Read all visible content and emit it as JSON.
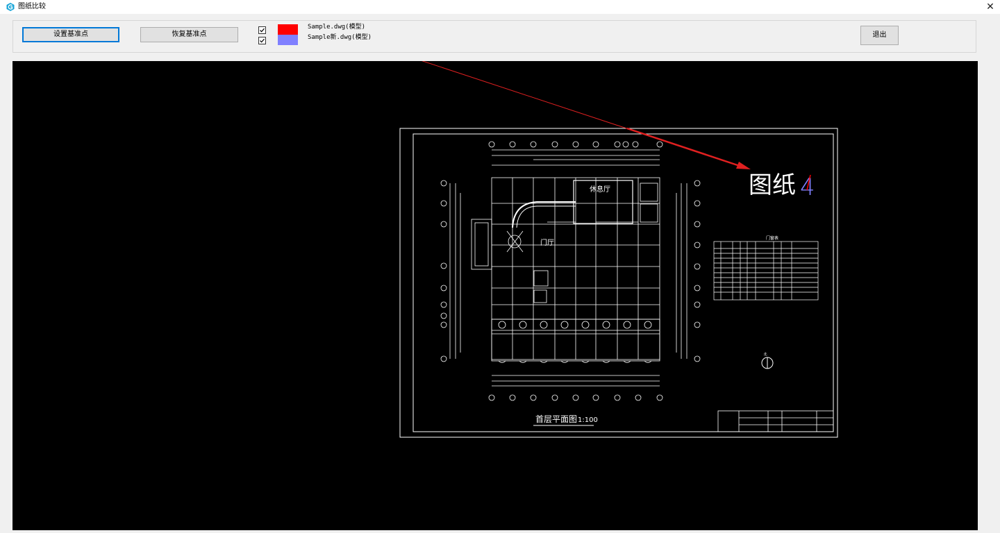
{
  "window": {
    "title": "图纸比较",
    "close_glyph": "✕"
  },
  "toolbar": {
    "set_base_point": "设置基准点",
    "restore_base_point": "恢复基准点",
    "exit": "退出"
  },
  "layers": [
    {
      "checked": true,
      "color": "#ff0000",
      "label": "Sample.dwg(模型)"
    },
    {
      "checked": true,
      "color": "#8080ff",
      "label": "Sample新.dwg(模型)"
    }
  ],
  "drawing": {
    "sheet_title": "图纸",
    "sheet_number": "4",
    "plan_title": "首层平面图",
    "plan_scale": "1:100",
    "table_title": "门窗表",
    "room_lounge": "休息厅",
    "room_lobby": "门厅",
    "compass_letter": "北"
  },
  "colors": {
    "canvas_bg": "#000000",
    "line_color": "#ffffff",
    "arrow_color": "#e02020",
    "accent_blue": "#0078d7"
  }
}
